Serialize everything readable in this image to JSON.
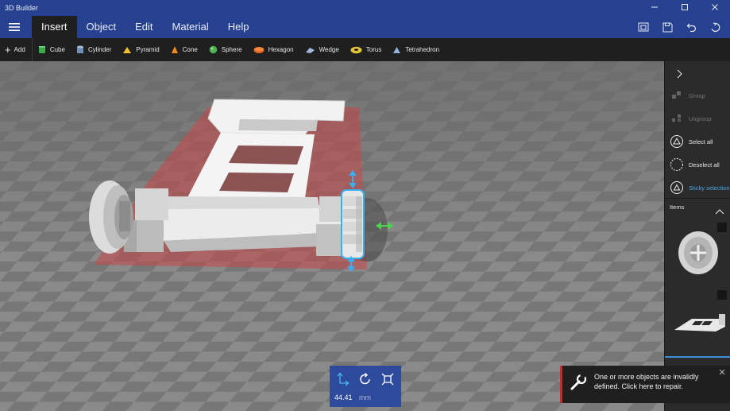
{
  "app": {
    "title": "3D Builder"
  },
  "window_controls": [
    "restore",
    "maximize",
    "close"
  ],
  "menu": {
    "tabs": [
      {
        "label": "Insert",
        "active": true
      },
      {
        "label": "Object",
        "active": false
      },
      {
        "label": "Edit",
        "active": false
      },
      {
        "label": "Material",
        "active": false
      },
      {
        "label": "Help",
        "active": false
      }
    ]
  },
  "toolbar_right": [
    "3d-view-icon",
    "save-icon",
    "undo-icon",
    "redo-icon"
  ],
  "ribbon": {
    "add_label": "Add",
    "shapes": [
      {
        "label": "Cube",
        "icon": "cube-icon",
        "color": "#3aa94a"
      },
      {
        "label": "Cylinder",
        "icon": "cylinder-icon",
        "color": "#6f8fb8"
      },
      {
        "label": "Pyramid",
        "icon": "pyramid-icon",
        "color": "#f2c12e"
      },
      {
        "label": "Cone",
        "icon": "cone-icon",
        "color": "#f08a1e"
      },
      {
        "label": "Sphere",
        "icon": "sphere-icon",
        "color": "#4caf50"
      },
      {
        "label": "Hexagon",
        "icon": "hexagon-icon",
        "color": "#e8641e"
      },
      {
        "label": "Wedge",
        "icon": "wedge-icon",
        "color": "#9fb7da"
      },
      {
        "label": "Torus",
        "icon": "torus-icon",
        "color": "#e2c43a"
      },
      {
        "label": "Tetrahedron",
        "icon": "tetrahedron-icon",
        "color": "#8fb4d8"
      }
    ]
  },
  "panel": {
    "group_label": "Group",
    "ungroup_label": "Ungroup",
    "select_all_label": "Select all",
    "deselect_all_label": "Deselect all",
    "sticky_selection_label": "Sticky selection",
    "items_label": "Items"
  },
  "transform": {
    "size_value": "44.41",
    "unit": "mm"
  },
  "notification": {
    "message": "One or more objects are invalidly defined. Click here to repair.",
    "accent_color": "#d42626"
  },
  "colors": {
    "title_bar": "#26418f",
    "ribbon": "#1f1f1f",
    "panel": "#2b2b2b",
    "selection": "#3aaef2",
    "accent": "#4aa7e8"
  }
}
